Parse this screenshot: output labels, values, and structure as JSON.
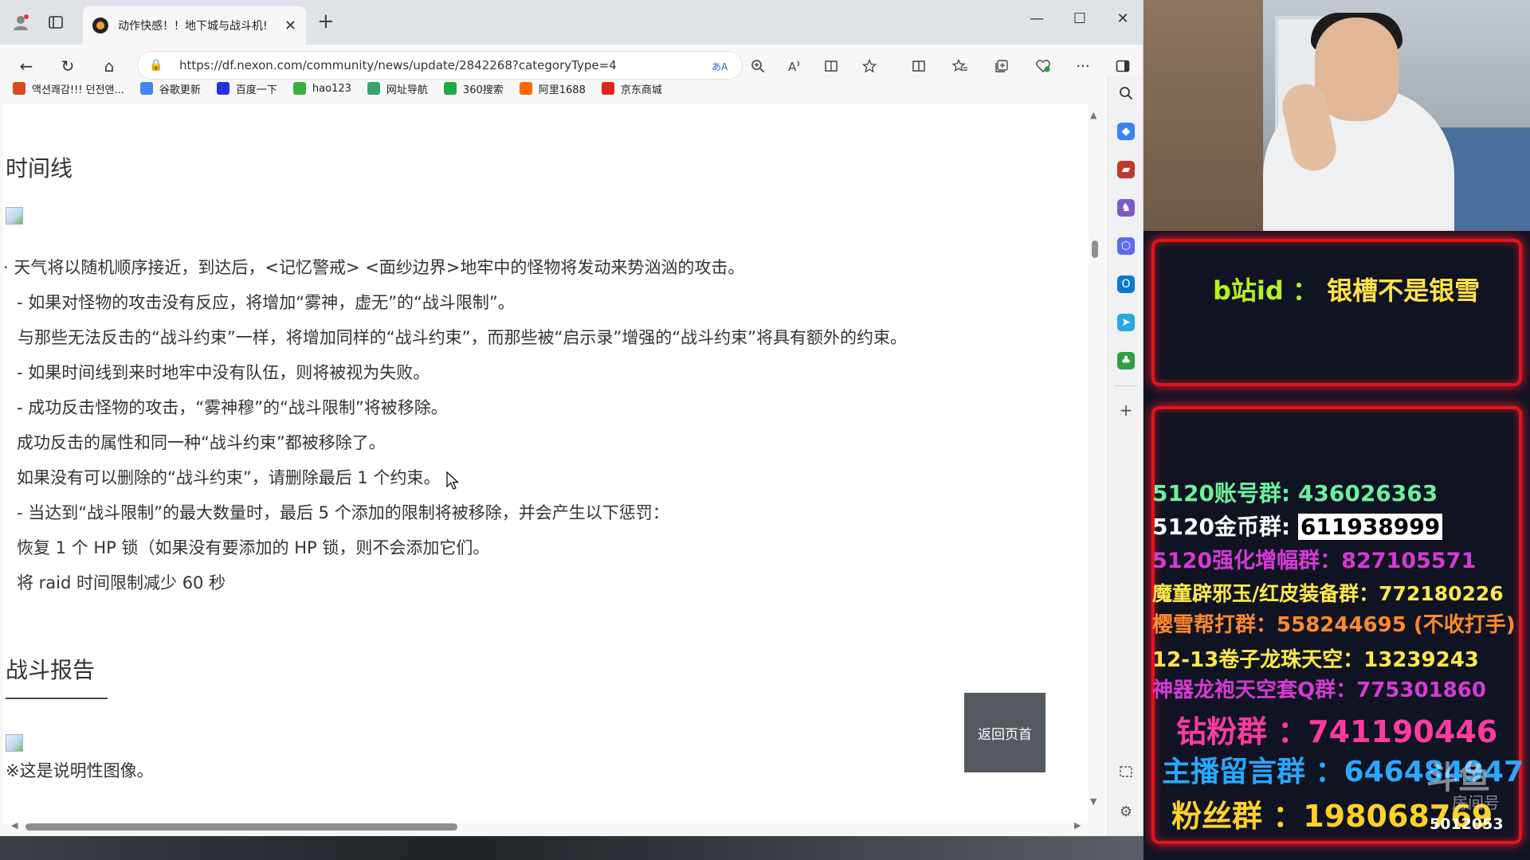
{
  "browser": {
    "tab": {
      "title": "动作快感！！地下城与战斗机!",
      "close": "✕",
      "new": "+"
    },
    "window_controls": {
      "minimize": "—",
      "maximize": "☐",
      "close": "✕"
    },
    "nav": {
      "back": "←",
      "refresh": "↻",
      "home": "⌂",
      "lock": "🔒",
      "more": "···"
    },
    "url": "https://df.nexon.com/community/news/update/2842268?categoryType=4",
    "bookmarks": [
      {
        "label": "액션쾌감!!! 던전앤...",
        "color": "#d84a1b"
      },
      {
        "label": "谷歌更新",
        "color": "#4285f4"
      },
      {
        "label": "百度一下",
        "color": "#2932e1"
      },
      {
        "label": "hao123",
        "color": "#3cae3c"
      },
      {
        "label": "网址导航",
        "color": "#37a46b"
      },
      {
        "label": "360搜索",
        "color": "#1faa44"
      },
      {
        "label": "阿里1688",
        "color": "#ff6a00"
      },
      {
        "label": "京东商城",
        "color": "#e1251b"
      }
    ]
  },
  "page": {
    "section1_title": "时间线",
    "lines": [
      "· 天气将以随机顺序接近，到达后，<记忆警戒> <面纱边界>地牢中的怪物将发动来势汹汹的攻击。",
      "- 如果对怪物的攻击没有反应，将增加“雾神，虚无”的“战斗限制”。",
      "与那些无法反击的“战斗约束”一样，将增加同样的“战斗约束”，而那些被“启示录”增强的“战斗约束”将具有额外的约束。",
      "- 如果时间线到来时地牢中没有队伍，则将被视为失败。",
      "- 成功反击怪物的攻击，“雾神穆”的“战斗限制”将被移除。",
      "成功反击的属性和同一种“战斗约束”都被移除了。",
      "如果没有可以删除的“战斗约束”，请删除最后 1 个约束。",
      "- 当达到“战斗限制”的最大数量时，最后 5 个添加的限制将被移除，并会产生以下惩罚：",
      "恢复 1 个 HP 锁（如果没有要添加的 HP 锁，则不会添加它们。",
      "将 raid 时间限制减少 60 秒"
    ],
    "section2_title": "战斗报告",
    "caption": "※这是说明性图像。",
    "back_to_top": "返回页首"
  },
  "overlay": {
    "bili_key": "b站id",
    "bili_sep": "：",
    "bili_value": "银槽不是银雪",
    "groups": [
      {
        "label": "5120账号群: ",
        "value": "436026363",
        "color": "#6cf0a0",
        "size": 28,
        "highlight": false
      },
      {
        "label": "5120金币群: ",
        "value": "611938999",
        "color": "#ffffff",
        "size": 28,
        "highlight": true
      },
      {
        "label": "5120强化增幅群：",
        "value": "827105571",
        "color": "#d63ad6",
        "size": 27,
        "highlight": false
      },
      {
        "label": "魔童辟邪玉/红皮装备群：",
        "value": "772180226",
        "color": "#ffe84a",
        "size": 25,
        "highlight": false
      },
      {
        "label": "樱雪帮打群：",
        "value": "558244695 (不收打手)",
        "color": "#ff8a2a",
        "size": 26,
        "highlight": false
      },
      {
        "label": "12-13卷子龙珠天空：",
        "value": "13239243",
        "color": "#ffe84a",
        "size": 26,
        "highlight": false
      },
      {
        "label": "神器龙袍天空套Q群：",
        "value": "775301860",
        "color": "#d63ad6",
        "size": 26,
        "highlight": false
      },
      {
        "label": "钻粉群 ：",
        "value": "741190446",
        "color": "#ff3aa0",
        "size": 38,
        "highlight": false
      },
      {
        "label": "主播留言群 ：",
        "value": "646484947",
        "color": "#2aa8ff",
        "size": 36,
        "highlight": false
      },
      {
        "label": "粉丝群 ：",
        "value": "198068769",
        "color": "#ffd12a",
        "size": 38,
        "highlight": false
      }
    ],
    "badge_logo": "斗鱼",
    "badge_logo_sub": "房间号",
    "badge_number": "5012053"
  }
}
